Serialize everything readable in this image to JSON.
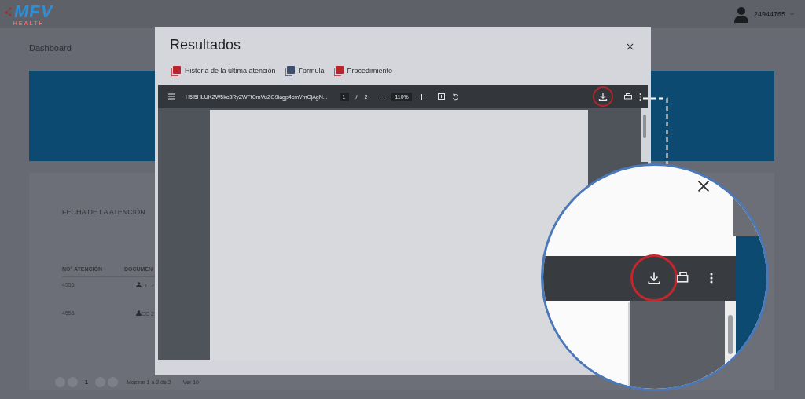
{
  "header": {
    "logo": {
      "text": "MFV",
      "subtitle": "HEALTH"
    },
    "user": {
      "id": "24944765"
    }
  },
  "page": {
    "title": "Dashboard",
    "filter_label": "FECHA DE LA ATENCIÓN",
    "table": {
      "columns": [
        "NO° ATENCIÓN",
        "DOCUMEN"
      ],
      "rows": [
        [
          "4556",
          "CC 2"
        ],
        [
          "4556",
          "CC 2"
        ]
      ]
    },
    "pagination": {
      "pages": [
        {
          "label": "1",
          "selected": true
        }
      ],
      "summary": "Mostrar 1 a 2 de 2",
      "page_size": "Ver 10"
    }
  },
  "modal": {
    "title": "Resultados",
    "tabs": [
      {
        "label": "Historia de la última atención",
        "color": "#b8262c"
      },
      {
        "label": "Formula",
        "color": "#3e4f6e"
      },
      {
        "label": "Procedimiento",
        "color": "#b8262c"
      }
    ],
    "viewer": {
      "filename": "H5I5HLUKZW5kc3RyZWFtCmVuZG9iagp4cmVmCjAgN...",
      "page": "1",
      "page_separator": "/",
      "page_count": "2",
      "zoom": "110%"
    }
  }
}
